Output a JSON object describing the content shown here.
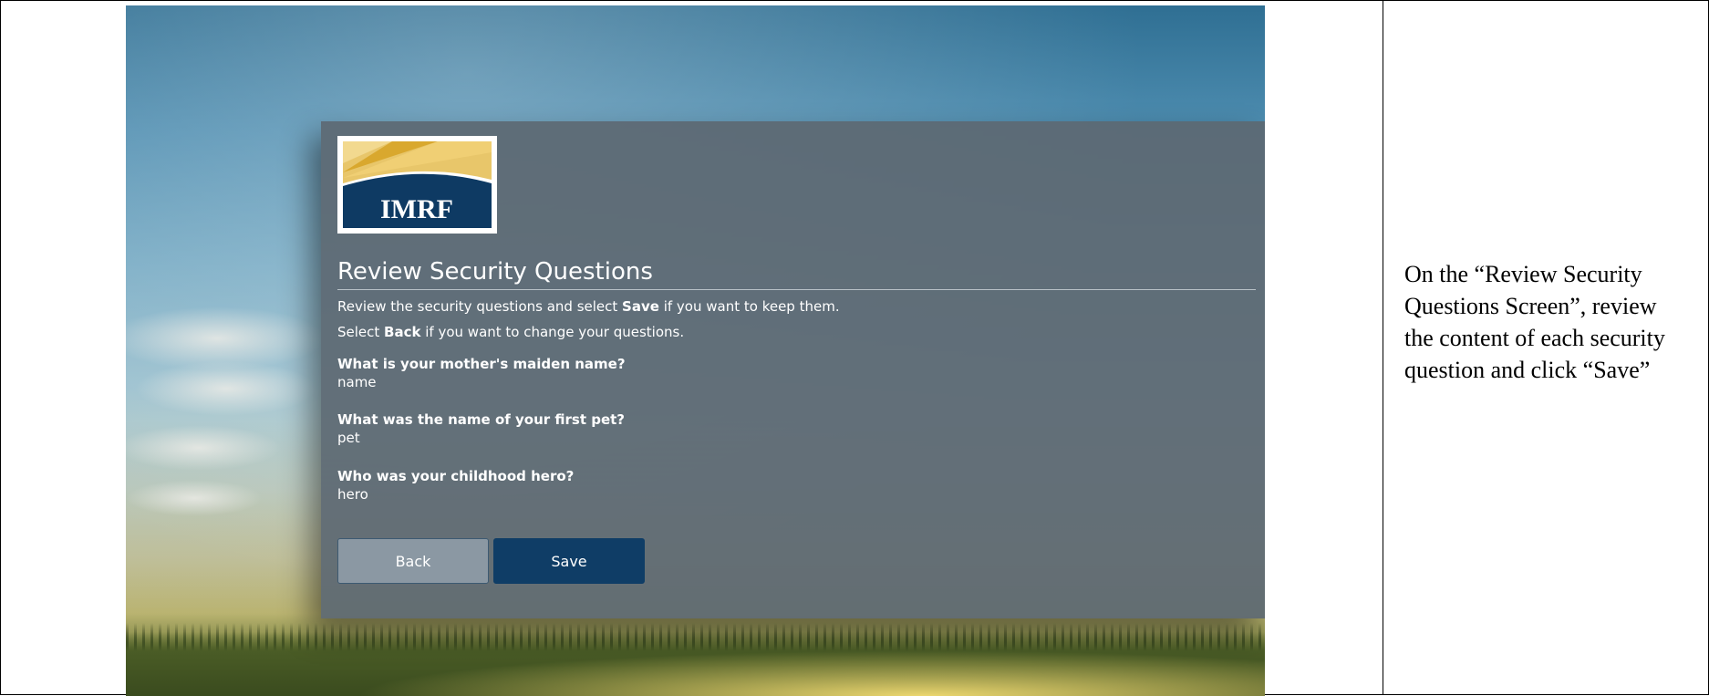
{
  "screen": {
    "logo_text": "IMRF",
    "title": "Review Security Questions",
    "instructions": {
      "line1_before": "Review the security questions and select ",
      "line1_bold": "Save",
      "line1_after": " if you want to keep them.",
      "line2_before": "Select ",
      "line2_bold": "Back",
      "line2_after": " if you want to change your questions."
    },
    "questions": [
      {
        "question": "What is your mother's maiden name?",
        "answer": "name"
      },
      {
        "question": "What was the name of your first pet?",
        "answer": "pet"
      },
      {
        "question": "Who was your childhood hero?",
        "answer": "hero"
      }
    ],
    "buttons": {
      "back": "Back",
      "save": "Save"
    },
    "colors": {
      "card": "#5c6872",
      "save_button": "#0f3d66",
      "back_button": "#8b98a3",
      "logo_navy": "#0e3a63",
      "logo_gold": "#d9a82e"
    }
  },
  "caption": "On the “Review Security Questions Screen”, review the content of each security question and click “Save”"
}
